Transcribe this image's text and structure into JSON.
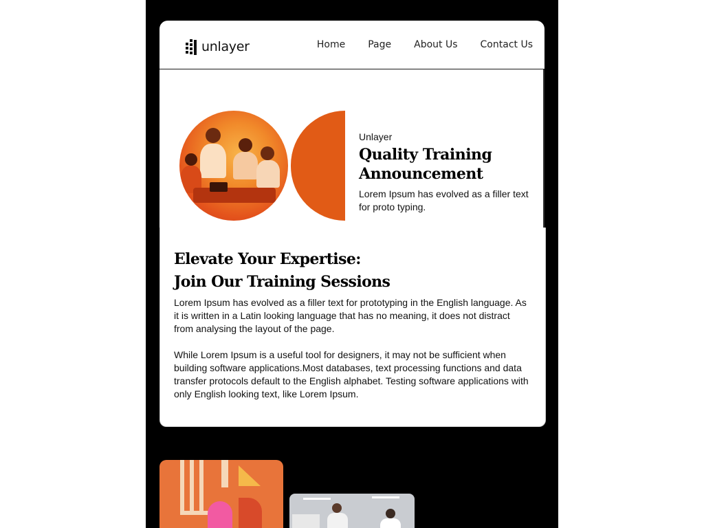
{
  "header": {
    "logo_text": "unlayer",
    "nav": [
      "Home",
      "Page",
      "About Us",
      "Contact Us"
    ]
  },
  "hero": {
    "brand": "Unlayer",
    "title_line1": "Quality Training",
    "title_line2": "Announcement",
    "subtitle": "Lorem Ipsum has evolved as a filler text for proto typing."
  },
  "content": {
    "title_line1": "Elevate Your Expertise:",
    "title_line2": "Join Our Training Sessions",
    "paragraph1": "Lorem Ipsum has evolved as a filler text for prototyping in the English language. As it is written in a Latin looking language that has no meaning, it does not distract from analysing the layout of the page.",
    "paragraph2": "While Lorem Ipsum is a useful tool for designers, it may not be sufficient when building software applications.Most databases, text processing functions and data transfer protocols default to the English alphabet. Testing software applications with only English looking text, like Lorem Ipsum."
  },
  "colors": {
    "accent_orange": "#e15b16",
    "background": "#000000",
    "card": "#ffffff"
  }
}
